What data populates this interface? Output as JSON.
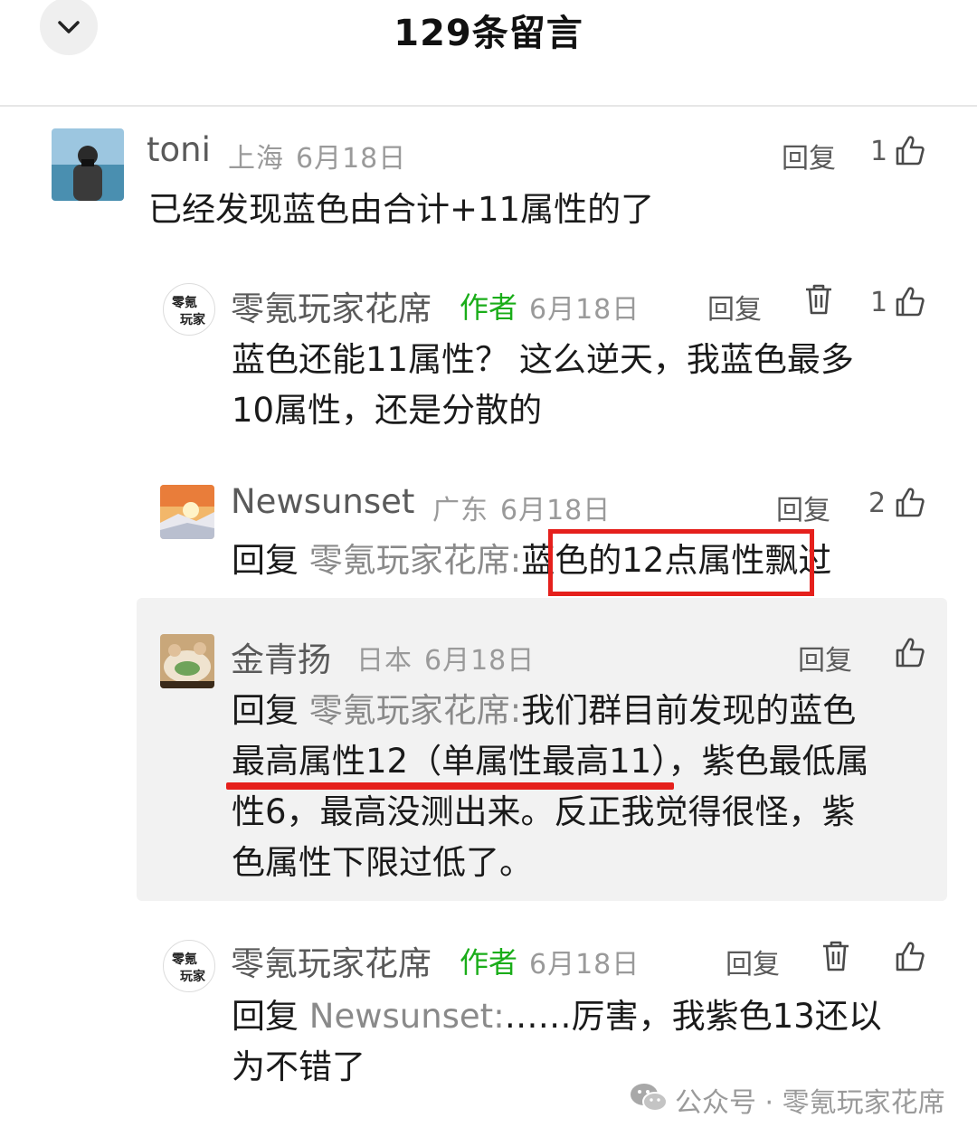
{
  "header": {
    "title": "129条留言"
  },
  "comments": [
    {
      "name": "toni",
      "location": "上海",
      "date": "6月18日",
      "reply": "回复",
      "likes": "1",
      "text": "已经发现蓝色由合计+11属性的了",
      "replies": [
        {
          "name": "零氪玩家花席",
          "author_tag": "作者",
          "date": "6月18日",
          "reply": "回复",
          "likes": "1",
          "avatar_text": [
            "零氪",
            "玩家"
          ],
          "lines": [
            "蓝色还能11属性？ 这么逆天，我蓝色最多",
            "10属性，还是分散的"
          ]
        },
        {
          "name": "Newsunset",
          "location": "广东",
          "date": "6月18日",
          "reply": "回复",
          "likes": "2",
          "reply_prefix": "回复",
          "reply_target": "零氪玩家花席:",
          "text": "蓝色的12点属性飘过"
        },
        {
          "name": "金青扬",
          "location": "日本",
          "date": "6月18日",
          "reply": "回复",
          "reply_prefix": "回复",
          "reply_target": "零氪玩家花席:",
          "lines": [
            "我们群目前发现的蓝色",
            "最高属性12（单属性最高11），紫色最低属",
            "性6，最高没测出来。反正我觉得很怪，紫",
            "色属性下限过低了。"
          ]
        },
        {
          "name": "零氪玩家花席",
          "author_tag": "作者",
          "date": "6月18日",
          "reply": "回复",
          "avatar_text": [
            "零氪",
            "玩家"
          ],
          "reply_prefix": "回复",
          "reply_target": "Newsunset:",
          "lines": [
            "……厉害，我紫色13还以",
            "为不错了"
          ]
        }
      ]
    }
  ],
  "watermark": {
    "text": "公众号 · 零氪玩家花席",
    "icon": "wechat-icon"
  },
  "colors": {
    "author_tag": "#1aad19",
    "annotation_red": "#e5201c",
    "highlight_bg": "#f2f2f2"
  }
}
